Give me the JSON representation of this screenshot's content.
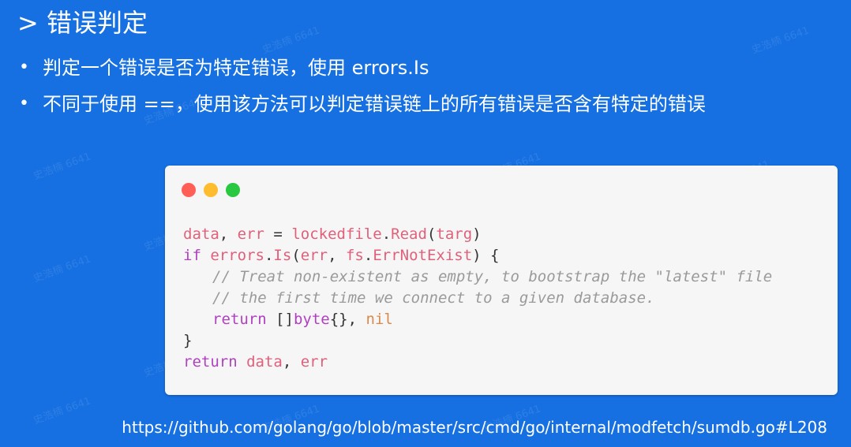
{
  "slide": {
    "title": "> 错误判定",
    "bullets": [
      "判定一个错误是否为特定错误，使用 errors.Is",
      "不同于使用 ==，使用该方法可以判定错误链上的所有错误是否含有特定的错误"
    ],
    "bullet_marker": "•",
    "link_url": "https://github.com/golang/go/blob/master/src/cmd/go/internal/modfetch/sumdb.go#L208",
    "watermark_text": "史浩楠 6641"
  },
  "code_window": {
    "dots": [
      "red",
      "yellow",
      "green"
    ],
    "dot_colors": {
      "red": "#ff5f57",
      "yellow": "#febc2e",
      "green": "#28c840"
    },
    "lines": {
      "l1": {
        "data": "data",
        "comma": ", ",
        "err": "err",
        "assign": " = ",
        "lockedfile": "lockedfile",
        "dot": ".",
        "read": "Read",
        "open": "(",
        "targ": "targ",
        "close": ")"
      },
      "l2": {
        "if": "if ",
        "errors": "errors",
        "dot": ".",
        "is": "Is",
        "open": "(",
        "err": "err",
        "comma": ", ",
        "fs": "fs",
        "dot2": ".",
        "errnotexist": "ErrNotExist",
        "close": ") {"
      },
      "l3": {
        "comment": "// Treat non-existent as empty, to bootstrap the \"latest\" file"
      },
      "l4": {
        "comment": "// the first time we connect to a given database."
      },
      "l5": {
        "return": "return ",
        "brackets": "[]",
        "byte": "byte",
        "braces": "{}, ",
        "nil": "nil"
      },
      "l6": {
        "brace": "}"
      },
      "l7": {
        "return": "return ",
        "data": "data",
        "comma": ", ",
        "err": "err"
      }
    }
  }
}
